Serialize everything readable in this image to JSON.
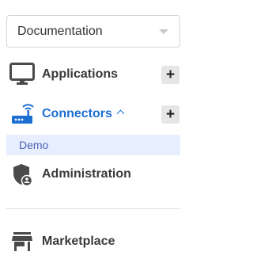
{
  "workspace_select": {
    "value": "Documentation"
  },
  "nav": {
    "applications": {
      "label": "Applications",
      "icon": "monitor-icon",
      "add_label": "+"
    },
    "connectors": {
      "label": "Connectors",
      "icon": "router-icon",
      "add_label": "+",
      "expanded": true,
      "children": [
        {
          "label": "Demo"
        }
      ]
    },
    "administration": {
      "label": "Administration",
      "icon": "shield-account-icon"
    },
    "marketplace": {
      "label": "Marketplace",
      "icon": "store-icon"
    }
  },
  "colors": {
    "accent": "#1c6fd1",
    "sub_bg": "#e7eeff",
    "sub_text": "#4b63b5",
    "icon": "#4a4a4a"
  }
}
